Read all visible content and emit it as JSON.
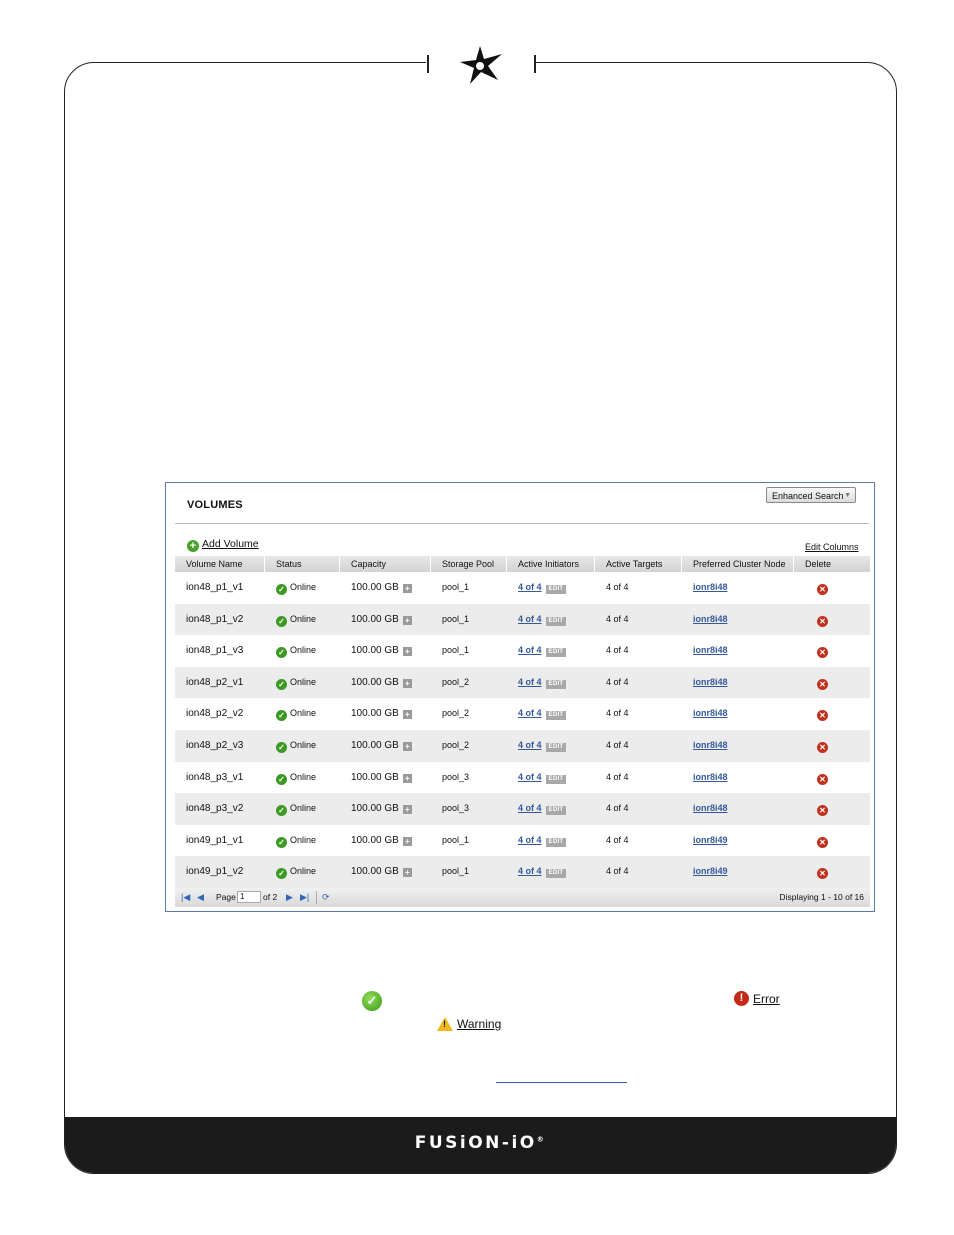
{
  "footer": {
    "brand": "FUSiON-iO",
    "mark": "®"
  },
  "panel": {
    "title": "VOLUMES",
    "enhanced_search": "Enhanced Search",
    "add_volume": "Add Volume",
    "edit_columns": "Edit Columns",
    "columns": [
      "Volume Name",
      "Status",
      "Capacity",
      "Storage Pool",
      "Active Initiators",
      "Active Targets",
      "Preferred Cluster Node",
      "Delete"
    ],
    "rows": [
      {
        "name": "ion48_p1_v1",
        "status": "Online",
        "capacity": "100.00 GB",
        "pool": "pool_1",
        "initiators": "4 of 4",
        "edit": "EDIT",
        "targets": "4 of 4",
        "node": "ionr8i48"
      },
      {
        "name": "ion48_p1_v2",
        "status": "Online",
        "capacity": "100.00 GB",
        "pool": "pool_1",
        "initiators": "4 of 4",
        "edit": "EDIT",
        "targets": "4 of 4",
        "node": "ionr8i48"
      },
      {
        "name": "ion48_p1_v3",
        "status": "Online",
        "capacity": "100.00 GB",
        "pool": "pool_1",
        "initiators": "4 of 4",
        "edit": "EDIT",
        "targets": "4 of 4",
        "node": "ionr8i48"
      },
      {
        "name": "ion48_p2_v1",
        "status": "Online",
        "capacity": "100.00 GB",
        "pool": "pool_2",
        "initiators": "4 of 4",
        "edit": "EDIT",
        "targets": "4 of 4",
        "node": "ionr8i48"
      },
      {
        "name": "ion48_p2_v2",
        "status": "Online",
        "capacity": "100.00 GB",
        "pool": "pool_2",
        "initiators": "4 of 4",
        "edit": "EDIT",
        "targets": "4 of 4",
        "node": "ionr8i48"
      },
      {
        "name": "ion48_p2_v3",
        "status": "Online",
        "capacity": "100.00 GB",
        "pool": "pool_2",
        "initiators": "4 of 4",
        "edit": "EDIT",
        "targets": "4 of 4",
        "node": "ionr8i48"
      },
      {
        "name": "ion48_p3_v1",
        "status": "Online",
        "capacity": "100.00 GB",
        "pool": "pool_3",
        "initiators": "4 of 4",
        "edit": "EDIT",
        "targets": "4 of 4",
        "node": "ionr8i48"
      },
      {
        "name": "ion48_p3_v2",
        "status": "Online",
        "capacity": "100.00 GB",
        "pool": "pool_3",
        "initiators": "4 of 4",
        "edit": "EDIT",
        "targets": "4 of 4",
        "node": "ionr8i48"
      },
      {
        "name": "ion49_p1_v1",
        "status": "Online",
        "capacity": "100.00 GB",
        "pool": "pool_1",
        "initiators": "4 of 4",
        "edit": "EDIT",
        "targets": "4 of 4",
        "node": "ionr8i49"
      },
      {
        "name": "ion49_p1_v2",
        "status": "Online",
        "capacity": "100.00 GB",
        "pool": "pool_1",
        "initiators": "4 of 4",
        "edit": "EDIT",
        "targets": "4 of 4",
        "node": "ionr8i49"
      }
    ],
    "pager": {
      "page_label": "Page",
      "page_value": "1",
      "of_pages": "of 2",
      "displaying": "Displaying 1 - 10 of 16"
    }
  },
  "legend": {
    "error": "Error",
    "warning": "Warning"
  },
  "icons": {
    "status_online": "check-circle-icon",
    "delete": "delete-icon",
    "error": "exclamation-circle-icon",
    "warning": "warning-triangle-icon"
  },
  "colors": {
    "online": "#3c9a22",
    "error": "#c42a16",
    "warning": "#f0b81c",
    "link": "#345a9a",
    "footer": "#1b1b1b"
  }
}
